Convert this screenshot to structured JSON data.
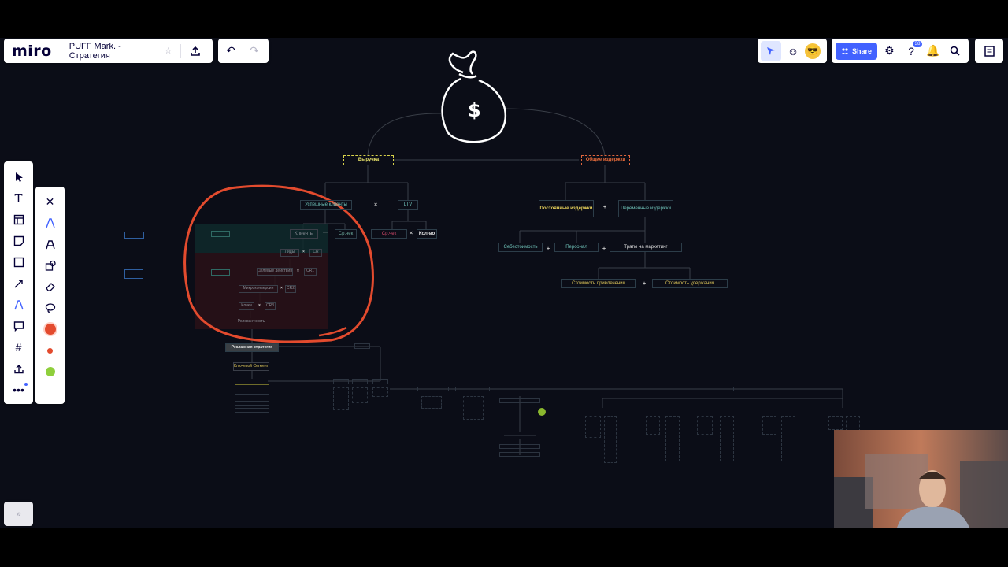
{
  "app": {
    "logo": "miro",
    "board_title": "PUFF Mark. - Стратегия"
  },
  "toolbar": {
    "share_label": "Share",
    "help_badge": "38"
  },
  "mindmap": {
    "revenue": "Выручка",
    "total_costs": "Общие издержки",
    "successful_clients": "Успешные клиенты",
    "ltv": "LTV",
    "fixed_costs": "Постоянные издержки",
    "variable_costs": "Переменные издержки",
    "clients": "Клиенты",
    "avg_check": "Ср.чек",
    "quantity": "Кол-во",
    "cost_price": "Себестоимость",
    "personnel": "Персонал",
    "marketing": "Траты на маркетинг",
    "acquisition_cost": "Стоимость привлечения",
    "retention_cost": "Стоимость удержания",
    "leads": "Лиды",
    "cr": "CR",
    "target_action": "Целевые действия",
    "cr1": "CR1",
    "micro_conversions": "Микроконверсии",
    "cr2": "CR2",
    "clicks": "Клики",
    "cr3": "CR3",
    "reach": "Релевантность",
    "ad_strategy": "Рекламная стратегия",
    "key_segment": "Ключевой Сегмент"
  }
}
